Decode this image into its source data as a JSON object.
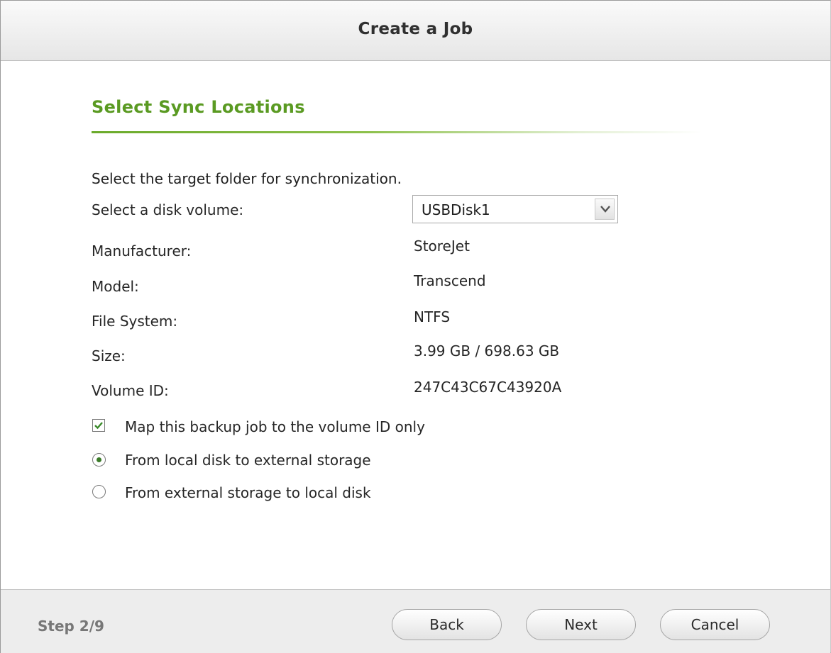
{
  "dialog": {
    "title": "Create a Job"
  },
  "section": {
    "title": "Select Sync Locations",
    "instruction": "Select the target folder for synchronization."
  },
  "volume": {
    "label": "Select a disk volume:",
    "selected": "USBDisk1"
  },
  "info": [
    {
      "label": "Manufacturer:",
      "value": "StoreJet"
    },
    {
      "label": "Model:",
      "value": "Transcend"
    },
    {
      "label": "File System:",
      "value": "NTFS"
    },
    {
      "label": "Size:",
      "value": "3.99 GB / 698.63 GB"
    },
    {
      "label": "Volume ID:",
      "value": "247C43C67C43920A"
    }
  ],
  "options": {
    "map_volume_id": {
      "label": "Map this backup job to the volume ID only",
      "checked": true
    },
    "direction": [
      {
        "label": "From local disk to external storage",
        "selected": true
      },
      {
        "label": "From external storage to local disk",
        "selected": false
      }
    ]
  },
  "footer": {
    "step": "Step 2/9",
    "back_label": "Back",
    "next_label": "Next",
    "cancel_label": "Cancel"
  },
  "colors": {
    "accent_green": "#5a9a22",
    "checkmark_green": "#3a8a2a"
  }
}
